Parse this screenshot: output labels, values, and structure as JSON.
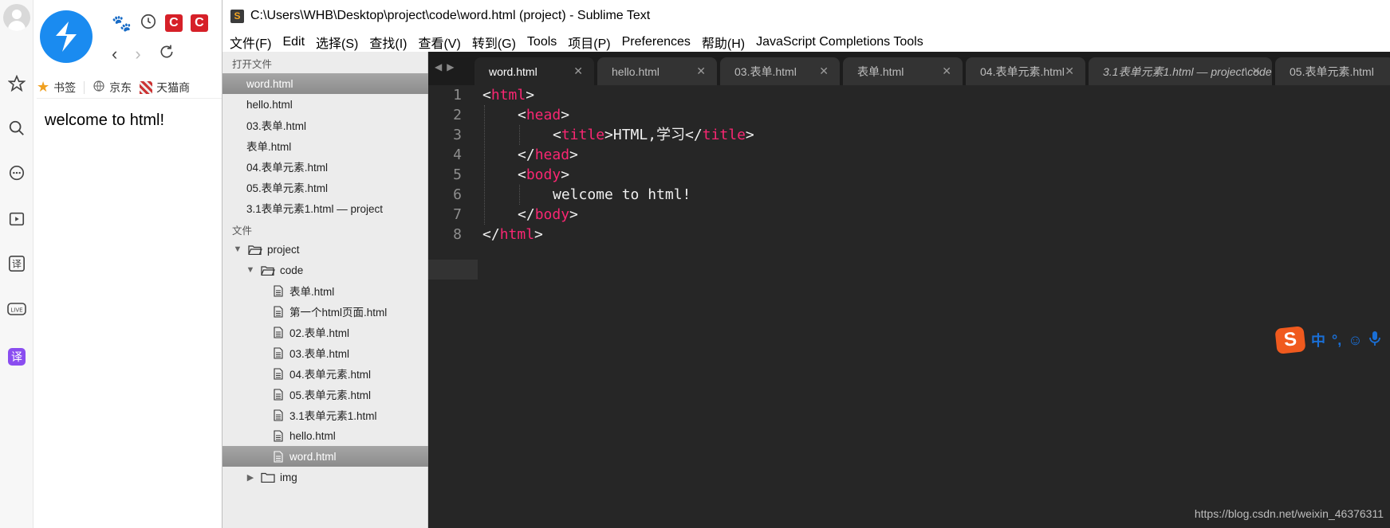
{
  "browser": {
    "bookmarks": [
      {
        "label": "书签",
        "icon": "star-icon"
      },
      {
        "label": "京东",
        "icon": "globe-icon"
      },
      {
        "label": "天猫商",
        "icon": "tmall-icon"
      }
    ],
    "page_text": "welcome to html!"
  },
  "sublime": {
    "title": "C:\\Users\\WHB\\Desktop\\project\\code\\word.html (project) - Sublime Text",
    "menu": [
      "文件(F)",
      "Edit",
      "选择(S)",
      "查找(I)",
      "查看(V)",
      "转到(G)",
      "Tools",
      "项目(P)",
      "Preferences",
      "帮助(H)",
      "JavaScript Completions Tools"
    ],
    "sidebar": {
      "open_files_header": "打开文件",
      "open_files": [
        "word.html",
        "hello.html",
        "03.表单.html",
        "表单.html",
        "04.表单元素.html",
        "05.表单元素.html",
        "3.1表单元素1.html — project"
      ],
      "folders_header": "文件",
      "tree": {
        "project": "project",
        "code": "code",
        "code_files": [
          "表单.html",
          "第一个html页面.html",
          "02.表单.html",
          "03.表单.html",
          "04.表单元素.html",
          "05.表单元素.html",
          "3.1表单元素1.html",
          "hello.html",
          "word.html"
        ],
        "img": "img"
      },
      "selected_open_file": "word.html",
      "selected_tree_file": "word.html"
    },
    "tabs": [
      {
        "label": "word.html",
        "active": true
      },
      {
        "label": "hello.html",
        "active": false
      },
      {
        "label": "03.表单.html",
        "active": false
      },
      {
        "label": "表单.html",
        "active": false
      },
      {
        "label": "04.表单元素.html",
        "active": false
      },
      {
        "label": "3.1表单元素1.html — project\\code",
        "active": false,
        "italic": true
      },
      {
        "label": "05.表单元素.html",
        "active": false
      }
    ],
    "line_numbers": [
      "1",
      "2",
      "3",
      "4",
      "5",
      "6",
      "7",
      "8"
    ],
    "current_line": "7",
    "code": {
      "l1_open": "<",
      "l1_tag": "html",
      "l1_close": ">",
      "l2_open": "<",
      "l2_tag": "head",
      "l2_close": ">",
      "l3_open": "<",
      "l3_tag": "title",
      "l3_mid": ">HTML,学习</",
      "l3_tag2": "title",
      "l3_close": ">",
      "l4_open": "</",
      "l4_tag": "head",
      "l4_close": ">",
      "l5_open": "<",
      "l5_tag": "body",
      "l5_close": ">",
      "l6_text": "welcome to html!",
      "l7_open": "</",
      "l7_tag": "body",
      "l7_close": ">",
      "l8_open": "</",
      "l8_tag": "html",
      "l8_close": ">"
    },
    "colors": {
      "tag": "#f92672",
      "editor_bg": "#262626",
      "text": "#f0f0f0"
    }
  },
  "ime": {
    "lang": "中",
    "punct": "°,",
    "emoji": "☺",
    "mic": "🎤"
  },
  "watermark": "https://blog.csdn.net/weixin_46376311"
}
